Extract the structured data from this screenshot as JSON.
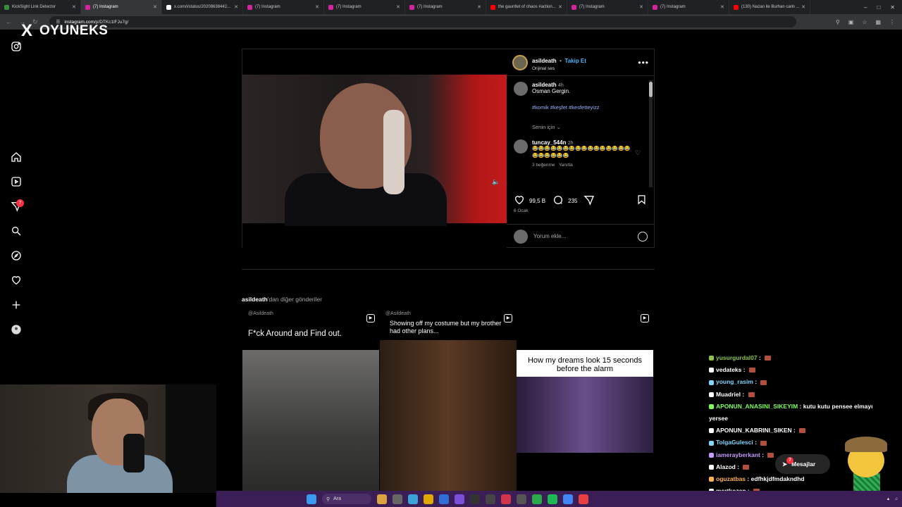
{
  "browser": {
    "tabs": [
      {
        "title": "KickSight Link Detector",
        "color": "#3b8f3b",
        "active": false
      },
      {
        "title": "(7) Instagram",
        "color": "#d6249f",
        "active": true
      },
      {
        "title": "x.com/i/status/20208638442...",
        "color": "#ffffff",
        "active": false
      },
      {
        "title": "(7) Instagram",
        "color": "#d6249f",
        "active": false
      },
      {
        "title": "(7) Instagram",
        "color": "#d6249f",
        "active": false
      },
      {
        "title": "(7) Instagram",
        "color": "#d6249f",
        "active": false
      },
      {
        "title": "the gauntlet of chaos #action...",
        "color": "#ff0000",
        "active": false
      },
      {
        "title": "(7) Instagram",
        "color": "#d6249f",
        "active": false
      },
      {
        "title": "(7) Instagram",
        "color": "#d6249f",
        "active": false
      },
      {
        "title": "(130) Nazan ile Burhan canlı ...",
        "color": "#ff0000",
        "active": false
      }
    ],
    "url_host": "instagram.com",
    "url_path": "/p/DTKc1lFJu7g/"
  },
  "overlay": {
    "logo_text": "OYUNEKS"
  },
  "sidebar": {
    "notification_count": "7"
  },
  "post": {
    "author": "asildeath",
    "follow_label": "Takip Et",
    "audio": "Orijinal ses",
    "caption_author": "asildeath",
    "caption_time": "4h",
    "caption_text": "Osman Gergin.",
    "hashtags": "#komik #keşfet #kesfetteyizz",
    "sort_label": "Senin için",
    "reply_user": "tuncay_544n",
    "reply_time": "2h",
    "reply_emojis": "😂😂😂😂😂😂😂😂😂😂😂😂😂😂😂😂😂😂😂😂😂😂",
    "reply_likes": "3 beğenme",
    "reply_action": "Yanıtla",
    "likes": "99,5 B",
    "comments": "235",
    "date": "6 Ocak",
    "comment_placeholder": "Yorum ekle..."
  },
  "more_posts": {
    "user": "asildeath",
    "suffix": "'dan diğer gönderiler",
    "items": [
      {
        "top_handle": "@Asildeath",
        "caption": "F*ck Around and Find out."
      },
      {
        "top_handle": "@Asildeath",
        "caption": "Showing off my costume but my brother had other plans..."
      },
      {
        "caption": "How my dreams look 15 seconds before the alarm"
      }
    ]
  },
  "chat": [
    {
      "user": "yusurgurdal07",
      "color": "#8bc34a",
      "msg": ""
    },
    {
      "user": "vedateks",
      "color": "#ffffff",
      "msg": ""
    },
    {
      "user": "young_rasim",
      "color": "#7fd6ff",
      "msg": ""
    },
    {
      "user": "Muadriel",
      "color": "#ffffff",
      "msg": ""
    },
    {
      "user": "APONUN_ANASINI_SIKEYIM",
      "color": "#7dff5a",
      "msg": "kutu kutu pensee elmayı yersee"
    },
    {
      "user": "APONUN_KABRINI_SIKEN",
      "color": "#ffffff",
      "msg": ""
    },
    {
      "user": "TolgaGulesci",
      "color": "#7fd6ff",
      "msg": ""
    },
    {
      "user": "iamerayberkant",
      "color": "#c89bff",
      "msg": ""
    },
    {
      "user": "Alazod",
      "color": "#ffffff",
      "msg": ""
    },
    {
      "user": "oguzatbas",
      "color": "#ffb347",
      "msg": "edfhkjdfmdakndhd"
    },
    {
      "user": "mertkozan",
      "color": "#ffffff",
      "msg": ""
    }
  ],
  "messages_button": {
    "label": "Mesajlar",
    "badge": "7"
  },
  "taskbar": {
    "search_label": "Ara"
  },
  "colors": {
    "accent_link": "#4cb5f9",
    "notification": "#ff3040",
    "taskbar": "#3a1e55"
  }
}
